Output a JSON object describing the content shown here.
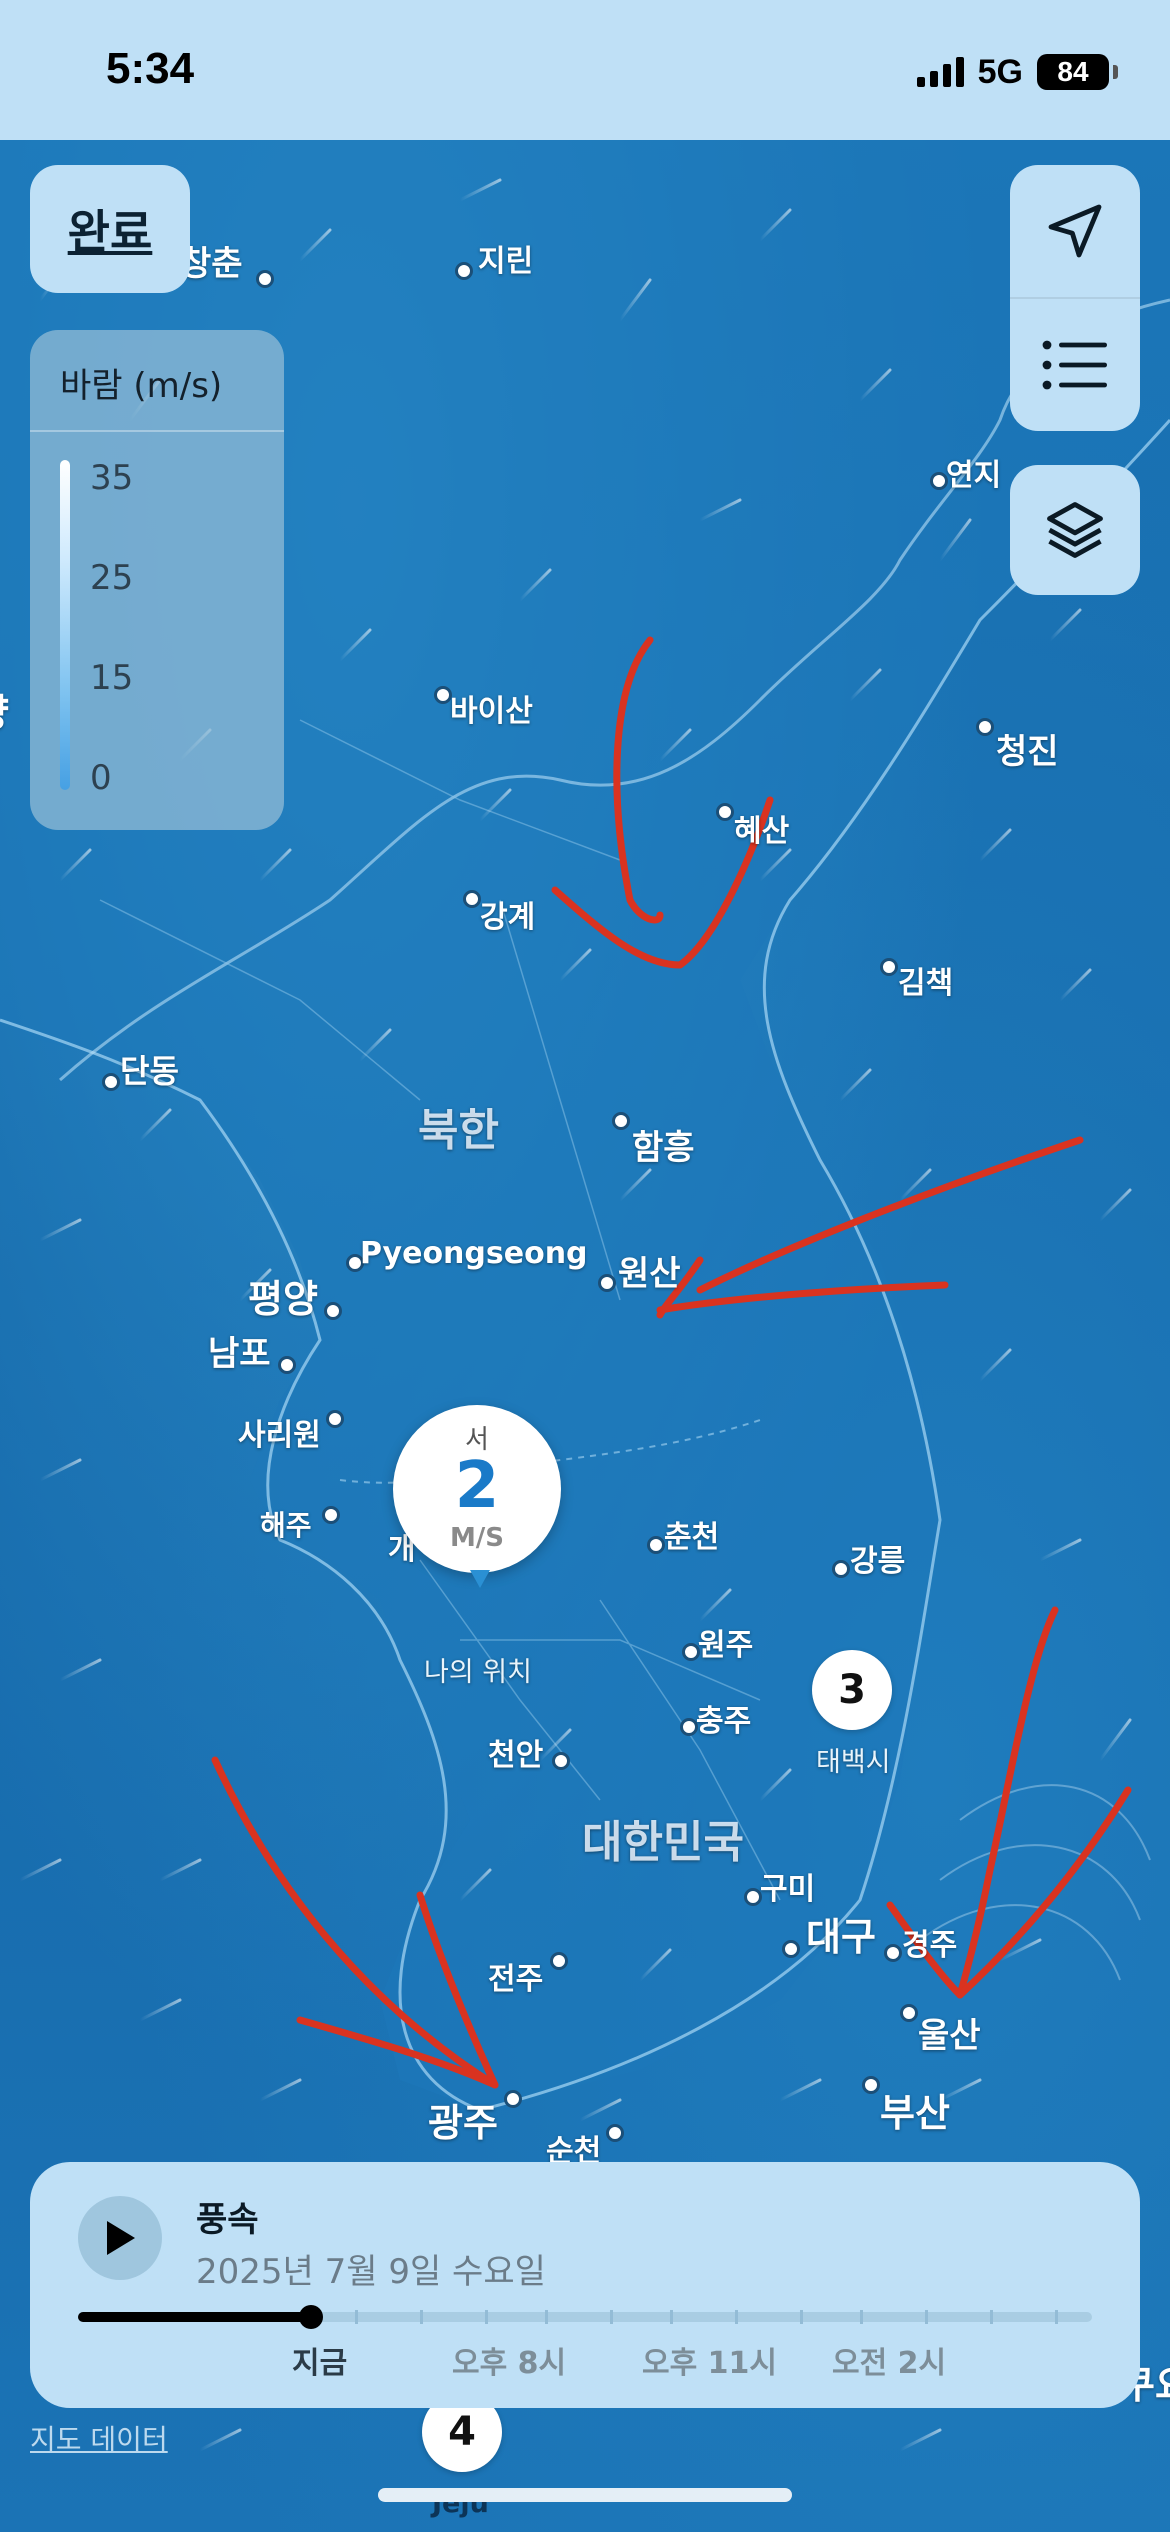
{
  "status_bar": {
    "time": "5:34",
    "network": "5G",
    "battery": "84"
  },
  "controls": {
    "done_label": "완료",
    "icons": [
      "location-arrow-icon",
      "list-icon",
      "layers-icon"
    ]
  },
  "legend": {
    "title": "바람 (m/s)",
    "ticks": [
      "35",
      "25",
      "15",
      "0"
    ]
  },
  "map": {
    "cities": [
      "창춘",
      "지린",
      "연지",
      "바이산",
      "청진",
      "혜산",
      "강계",
      "김책",
      "단동",
      "함흥",
      "평양",
      "Pyeongseong",
      "원산",
      "남포",
      "사리원",
      "해주",
      "개",
      "춘천",
      "강릉",
      "원주",
      "충주",
      "천안",
      "태백시",
      "구미",
      "대구",
      "경주",
      "울산",
      "부산",
      "전주",
      "광주",
      "순천",
      "양",
      "쿠요",
      "Jeju"
    ],
    "regions": [
      "북한",
      "대한민국"
    ],
    "my_location_label": "나의 위치",
    "badges": [
      "3",
      "4"
    ]
  },
  "wind_marker": {
    "direction": "서",
    "speed": "2",
    "unit": "M/S"
  },
  "playback": {
    "title": "풍속",
    "date": "2025년 7월 9일 수요일",
    "progress": 0.23,
    "time_labels": [
      "지금",
      "오후 8시",
      "오후 11시",
      "오전 2시"
    ]
  },
  "footer": {
    "map_data_link": "지도 데이터"
  },
  "colors": {
    "map_blue": "#1a74b6",
    "panel_blue": "#bfe0f6",
    "accent_blue": "#1a7ac8",
    "annotation_red": "#d93320"
  }
}
